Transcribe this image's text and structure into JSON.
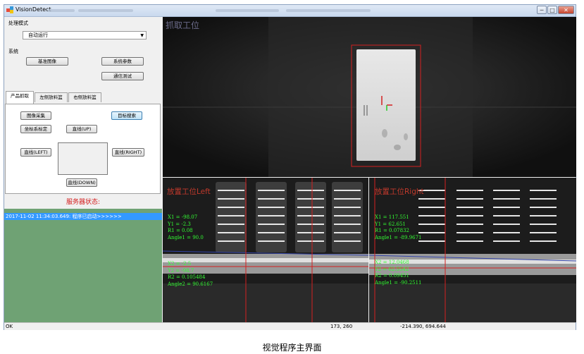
{
  "window": {
    "title": "VisionDetect",
    "controls": {
      "minimize": "─",
      "maximize": "□",
      "close": "✕"
    }
  },
  "left_panel": {
    "mode_label": "处理模式",
    "mode_value": "自动运行",
    "system_label": "系统",
    "buttons": {
      "base_image": "基准图像",
      "system_params": "系统参数",
      "comm_test": "通信测试"
    },
    "tabs": [
      "产品抓取",
      "左侧放料篮",
      "右侧放料篮"
    ],
    "tab_buttons": {
      "image_capture": "图像采集",
      "target_search": "目标搜索",
      "coord_calib": "坐标系标定",
      "line_up": "直线(UP)",
      "line_left": "直线(LEFT)",
      "line_right": "直线(RIGHT)",
      "line_down": "直线(DOWN)"
    },
    "server_status_label": "服务器状态:",
    "log": [
      "2017-11-02 11:34:03.649: 程序已启动>>>>>>"
    ]
  },
  "views": {
    "top": {
      "label": "抓取工位"
    },
    "bottom_left": {
      "label": "放置工位Left",
      "lines": [
        "X1 = -98.07",
        "Y1 = -2.3",
        "R1 = 0.08",
        "Angle1 = 90.0",
        "X2 = -2.5",
        "Y2 = -98.7",
        "R2 = 0.105484",
        "Angle2 = 90.6167"
      ]
    },
    "bottom_right": {
      "label": "放置工位Right",
      "lines": [
        "X1 = 117.551",
        "Y1 = 62.651",
        "R1 = 0.07832",
        "Angle1 = -89.9671",
        "X2 = 12.0468",
        "Y2 = 62.5542",
        "R2 = 0.09451",
        "Angle1 = -90.2511"
      ]
    }
  },
  "status_bar": {
    "status": "OK",
    "pixel": "173, 260",
    "world": "-214.390, 694.644"
  },
  "caption": "视觉程序主界面",
  "colors": {
    "accent_red": "#d31a1a",
    "log_bg": "#6fa274",
    "log_selected": "#3399ff",
    "measure_green": "#33ff33"
  }
}
